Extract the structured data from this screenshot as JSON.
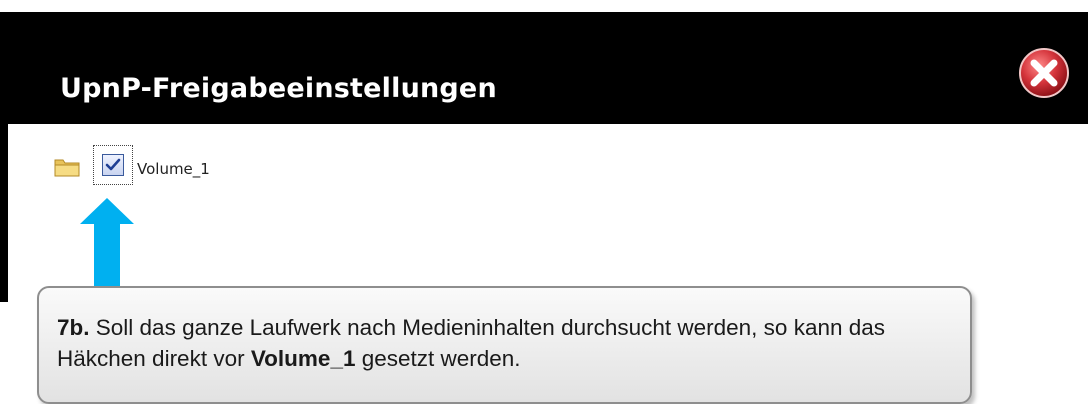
{
  "dialog": {
    "title": "UpnP-Freigabeeinstellungen",
    "close_icon": "close-icon"
  },
  "tree": {
    "folder_icon": "folder-icon",
    "item_label": "Volume_1",
    "checked": true
  },
  "annotation": {
    "arrow_icon": "arrow-up-icon",
    "step": "7b.",
    "text_1": " Soll das ganze Laufwerk nach Medieninhalten durchsucht werden, so kann das Häkchen direkt vor ",
    "emphasis": "Volume_1",
    "text_2": " gesetzt werden."
  },
  "colors": {
    "titlebar": "#000000",
    "arrow": "#00b0f0",
    "close_button": "#c0262d"
  }
}
